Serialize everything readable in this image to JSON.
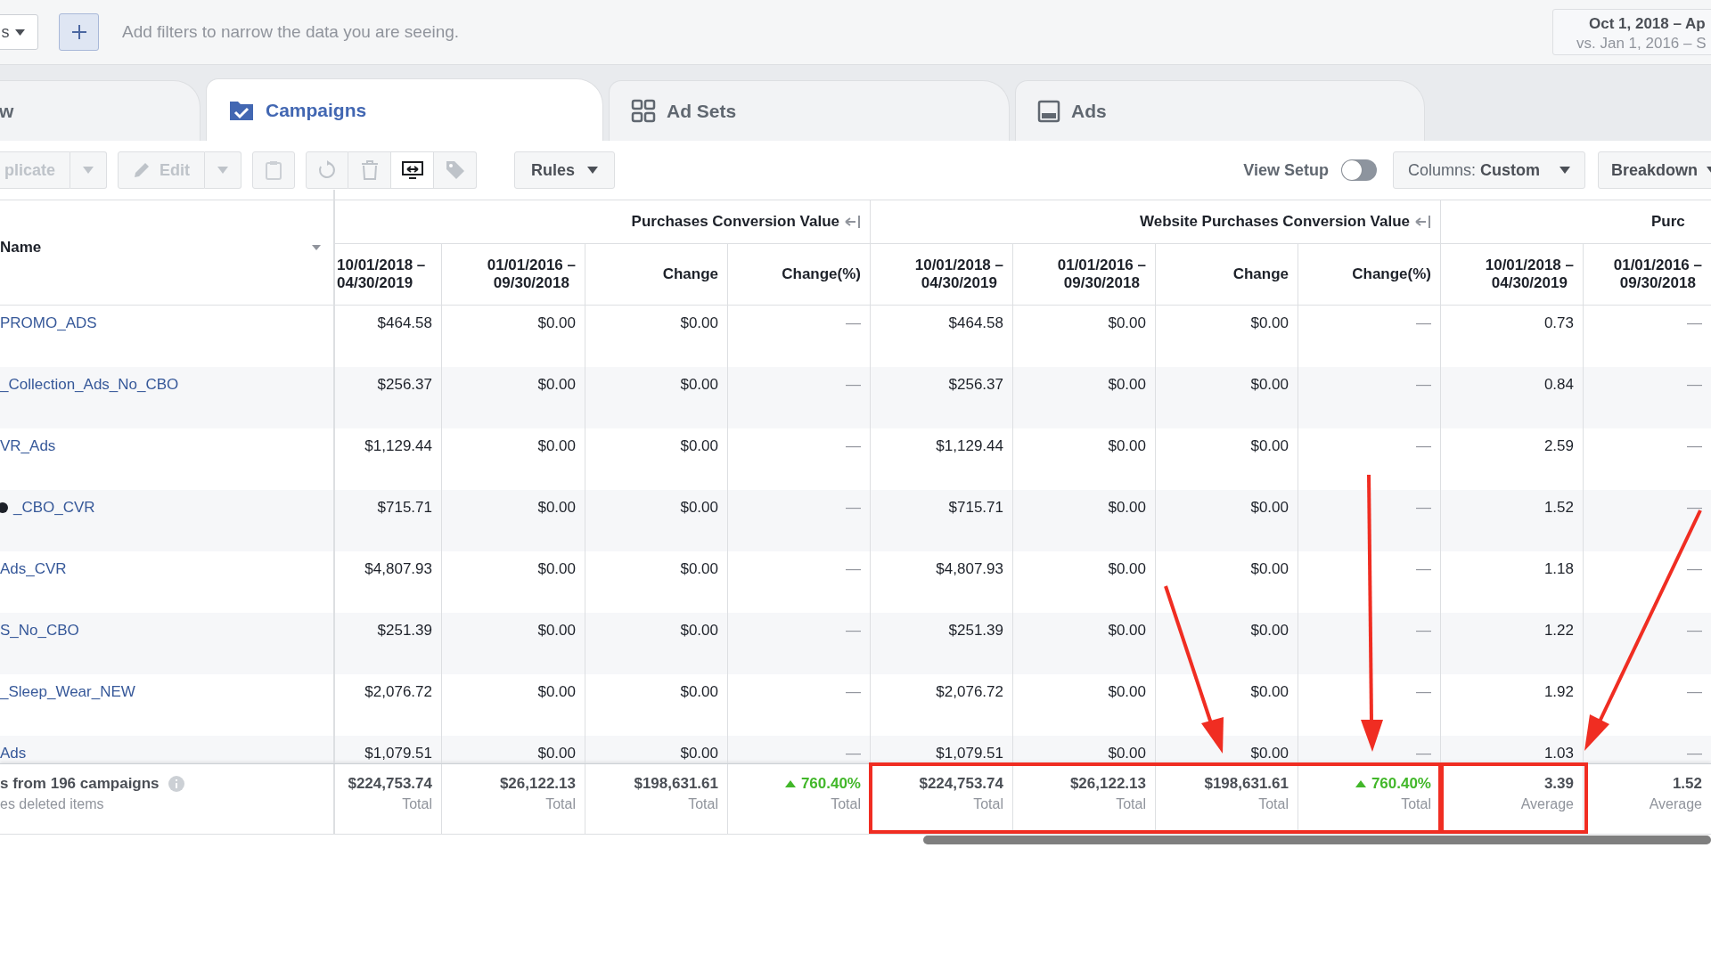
{
  "filter_bar": {
    "dropdown": "s",
    "placeholder": "Add filters to narrow the data you are seeing.",
    "date_range": {
      "primary": "Oct 1, 2018 – Ap",
      "comparison": "vs. Jan 1, 2016 – S"
    }
  },
  "tabs": [
    {
      "label": "w",
      "selected": false
    },
    {
      "label": "Campaigns",
      "selected": true
    },
    {
      "label": "Ad Sets",
      "selected": false
    },
    {
      "label": "Ads",
      "selected": false
    }
  ],
  "toolbar": {
    "groups": [
      {
        "items": [
          {
            "kind": "text",
            "label": "plicate",
            "disabled": true
          },
          {
            "kind": "caret",
            "disabled": true
          }
        ]
      },
      {
        "items": [
          {
            "kind": "text",
            "label": "Edit",
            "disabled": true
          },
          {
            "kind": "caret",
            "disabled": true
          }
        ]
      },
      {
        "items": [
          {
            "kind": "icon",
            "disabled": true
          }
        ]
      },
      {
        "items": [
          {
            "kind": "icon",
            "disabled": true
          },
          {
            "kind": "icon",
            "disabled": true
          },
          {
            "kind": "icon",
            "disabled": false
          },
          {
            "kind": "icon",
            "disabled": true
          }
        ]
      },
      {
        "items": [
          {
            "kind": "menu",
            "label": "Rules",
            "disabled": false
          }
        ]
      }
    ],
    "view_setup": {
      "label": "View Setup",
      "on": false
    },
    "columns": {
      "label": "Columns:",
      "value": "Custom"
    },
    "breakdown": "Breakdown"
  },
  "table": {
    "name_header": "Name",
    "groups": [
      {
        "title": "Purchases Conversion Value",
        "collapse": true,
        "columns": [
          "10/01/2018 –\n04/30/2019",
          "01/01/2016 –\n09/30/2018",
          "Change",
          "Change(%)"
        ]
      },
      {
        "title": "Website Purchases Conversion Value",
        "collapse": true,
        "columns": [
          "10/01/2018 –\n04/30/2019",
          "01/01/2016 –\n09/30/2018",
          "Change",
          "Change(%)"
        ]
      },
      {
        "title": "Purc",
        "collapse": false,
        "columns": [
          "10/01/2018 –\n04/30/2019",
          "01/01/2016 –\n09/30/2018"
        ]
      }
    ],
    "rows": [
      {
        "name": "PROMO_ADS",
        "dot": false,
        "cells": [
          "$464.58",
          "$0.00",
          "$0.00",
          "—",
          "$464.58",
          "$0.00",
          "$0.00",
          "—",
          "0.73",
          "—"
        ]
      },
      {
        "name": "_Collection_Ads_No_CBO",
        "dot": false,
        "cells": [
          "$256.37",
          "$0.00",
          "$0.00",
          "—",
          "$256.37",
          "$0.00",
          "$0.00",
          "—",
          "0.84",
          "—"
        ]
      },
      {
        "name": "VR_Ads",
        "dot": false,
        "cells": [
          "$1,129.44",
          "$0.00",
          "$0.00",
          "—",
          "$1,129.44",
          "$0.00",
          "$0.00",
          "—",
          "2.59",
          "—"
        ]
      },
      {
        "name": "_CBO_CVR",
        "dot": true,
        "cells": [
          "$715.71",
          "$0.00",
          "$0.00",
          "—",
          "$715.71",
          "$0.00",
          "$0.00",
          "—",
          "1.52",
          "—"
        ]
      },
      {
        "name": "Ads_CVR",
        "dot": false,
        "cells": [
          "$4,807.93",
          "$0.00",
          "$0.00",
          "—",
          "$4,807.93",
          "$0.00",
          "$0.00",
          "—",
          "1.18",
          "—"
        ]
      },
      {
        "name": "S_No_CBO",
        "dot": false,
        "cells": [
          "$251.39",
          "$0.00",
          "$0.00",
          "—",
          "$251.39",
          "$0.00",
          "$0.00",
          "—",
          "1.22",
          "—"
        ]
      },
      {
        "name": "_Sleep_Wear_NEW",
        "dot": false,
        "cells": [
          "$2,076.72",
          "$0.00",
          "$0.00",
          "—",
          "$2,076.72",
          "$0.00",
          "$0.00",
          "—",
          "1.92",
          "—"
        ]
      },
      {
        "name": "Ads",
        "dot": false,
        "cells": [
          "$1,079.51",
          "$0.00",
          "$0.00",
          "—",
          "$1,079.51",
          "$0.00",
          "$0.00",
          "—",
          "1.03",
          "—"
        ]
      }
    ],
    "footer": {
      "title": "s from 196 campaigns",
      "subtitle": "es deleted items",
      "cells": [
        {
          "value": "$224,753.74",
          "label": "Total",
          "increase": false
        },
        {
          "value": "$26,122.13",
          "label": "Total",
          "increase": false
        },
        {
          "value": "$198,631.61",
          "label": "Total",
          "increase": false
        },
        {
          "value": "760.40%",
          "label": "Total",
          "increase": true
        },
        {
          "value": "$224,753.74",
          "label": "Total",
          "increase": false
        },
        {
          "value": "$26,122.13",
          "label": "Total",
          "increase": false
        },
        {
          "value": "$198,631.61",
          "label": "Total",
          "increase": false
        },
        {
          "value": "760.40%",
          "label": "Total",
          "increase": true
        },
        {
          "value": "3.39",
          "label": "Average",
          "increase": false
        },
        {
          "value": "1.52",
          "label": "Average",
          "increase": false
        }
      ]
    }
  }
}
